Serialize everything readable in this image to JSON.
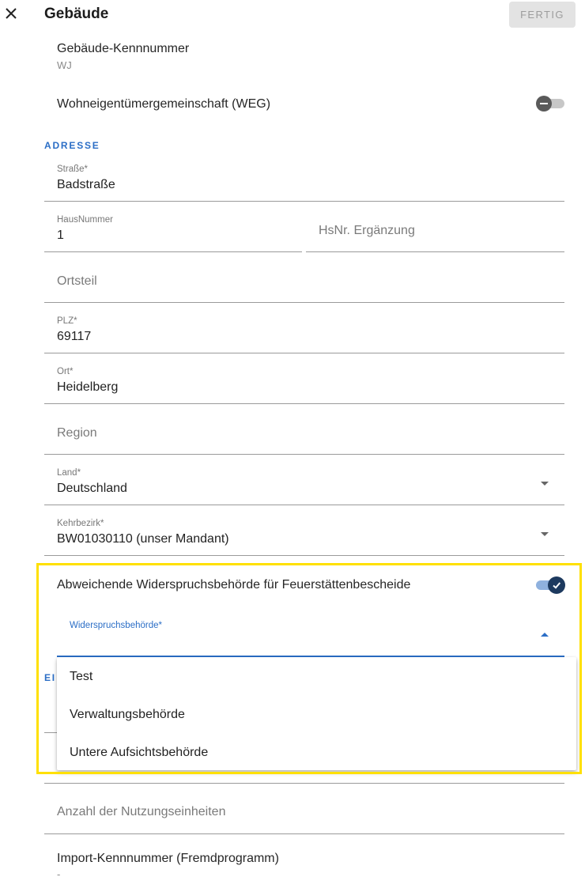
{
  "header": {
    "title": "Gebäude",
    "done_label": "FERTIG"
  },
  "building_id": {
    "label": "Gebäude-Kennnummer",
    "value": "WJ"
  },
  "weg": {
    "label": "Wohneigentümergemeinschaft (WEG)",
    "enabled": false
  },
  "address": {
    "section_title": "ADRESSE",
    "street": {
      "label": "Straße*",
      "value": "Badstraße"
    },
    "house_number": {
      "label": "HausNummer",
      "value": "1"
    },
    "house_number_suffix": {
      "placeholder": "HsNr. Ergänzung"
    },
    "district": {
      "placeholder": "Ortsteil"
    },
    "zip": {
      "label": "PLZ*",
      "value": "69117"
    },
    "city": {
      "label": "Ort*",
      "value": "Heidelberg"
    },
    "region": {
      "placeholder": "Region"
    },
    "country": {
      "label": "Land*",
      "value": "Deutschland"
    },
    "sweep_district": {
      "label": "Kehrbezirk*",
      "value": "BW01030110 (unser Mandant)"
    }
  },
  "objection_authority_toggle": {
    "label": "Abweichende Widerspruchsbehörde für Feuerstättenbescheide",
    "enabled": true
  },
  "objection_authority": {
    "label": "Widerspruchsbehörde*",
    "options": [
      "Test",
      "Verwaltungsbehörde",
      "Untere Aufsichtsbehörde"
    ]
  },
  "hidden_section_fragment": "EI",
  "usage_units": {
    "placeholder": "Anzahl der Nutzungseinheiten"
  },
  "import_id": {
    "label": "Import-Kennnummer (Fremdprogramm)",
    "value": "-"
  },
  "colors": {
    "accent": "#2b6ec6",
    "toggle_on": "#1d3a5f",
    "highlight": "#ffe000"
  }
}
